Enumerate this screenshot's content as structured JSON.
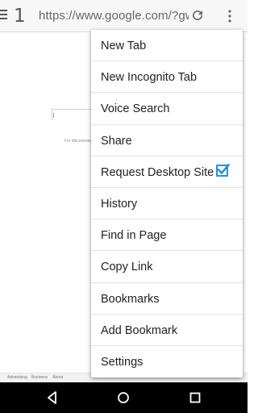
{
  "toolbar": {
    "tab_count": "1",
    "url": "https://www.google.com/?gws_rd=ssl"
  },
  "page": {
    "tagline": "For discovering th",
    "footer_links": [
      "Advertising",
      "Business",
      "About"
    ]
  },
  "menu": {
    "items": [
      {
        "label": "New Tab"
      },
      {
        "label": "New Incognito Tab"
      },
      {
        "label": "Voice Search"
      },
      {
        "label": "Share"
      },
      {
        "label": "Request Desktop Site",
        "checked": true
      },
      {
        "label": "History"
      },
      {
        "label": "Find in Page"
      },
      {
        "label": "Copy Link"
      },
      {
        "label": "Bookmarks"
      },
      {
        "label": "Add Bookmark"
      },
      {
        "label": "Settings"
      }
    ]
  },
  "colors": {
    "accent": "#2b8fd8",
    "navbar": "#000000"
  },
  "icons": [
    "menu-icon",
    "reload-icon",
    "overflow-icon",
    "checkmark-icon",
    "back-icon",
    "home-icon",
    "recents-icon"
  ]
}
